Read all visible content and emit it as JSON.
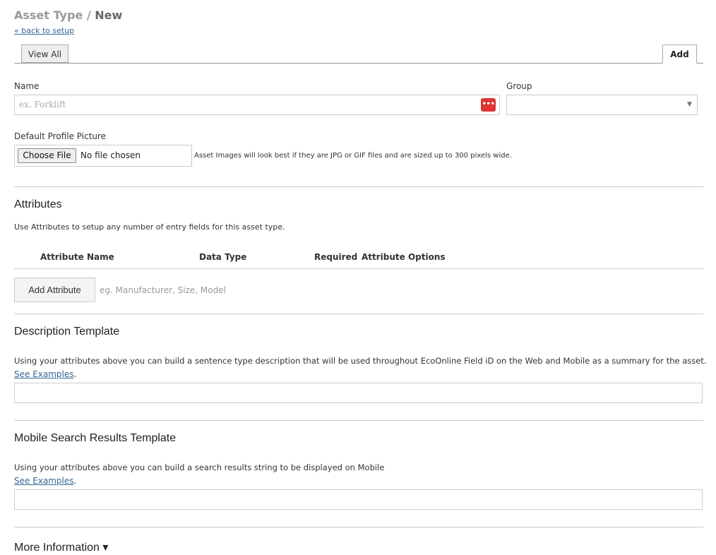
{
  "header": {
    "title_prefix": "Asset Type /",
    "title_current": "New",
    "back_link": "« back to setup"
  },
  "tabs": [
    {
      "label": "View All",
      "active": false
    },
    {
      "label": "Add",
      "active": true
    }
  ],
  "form": {
    "name_label": "Name",
    "name_placeholder": "ex. Forklift",
    "password_manager_icon": "•••",
    "group_label": "Group",
    "group_value": "",
    "picture_label": "Default Profile Picture",
    "choose_file_label": "Choose File",
    "no_file_text": "No file chosen",
    "picture_hint": "Asset Images will look best if they are JPG or GIF files and are sized up to 300 pixels wide."
  },
  "attributes": {
    "heading": "Attributes",
    "description": "Use Attributes to setup any number of entry fields for this asset type.",
    "columns": [
      "Attribute Name",
      "Data Type",
      "Required",
      "Attribute Options"
    ],
    "add_button": "Add Attribute",
    "add_placeholder": "eg. Manufacturer, Size, Model"
  },
  "description_template": {
    "heading": "Description Template",
    "text": "Using your attributes above you can build a sentence type description that will be used throughout EcoOnline Field iD on the Web and Mobile as a summary for the asset.",
    "examples_link": "See Examples",
    "period": ".",
    "value": ""
  },
  "mobile_template": {
    "heading": "Mobile Search Results Template",
    "text": "Using your attributes above you can build a search results string to be displayed on Mobile",
    "examples_link": "See Examples",
    "period": ".",
    "value": ""
  },
  "more_info": {
    "label": "More Information ▾"
  },
  "colors": {
    "link": "#336699",
    "password_icon_bg": "#dd3333"
  }
}
